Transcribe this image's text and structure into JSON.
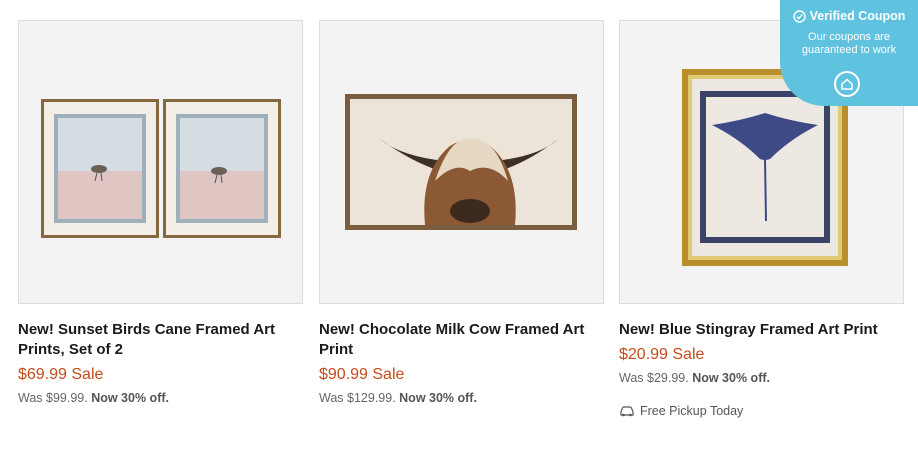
{
  "products": [
    {
      "title": "New! Sunset Birds Cane Framed Art Prints, Set of 2",
      "price": "$69.99 Sale",
      "was": "Was $99.99.",
      "discount": "Now 30% off.",
      "image_icon": "framed-art-birds-image"
    },
    {
      "title": "New! Chocolate Milk Cow Framed Art Print",
      "price": "$90.99 Sale",
      "was": "Was $129.99.",
      "discount": "Now 30% off.",
      "image_icon": "framed-art-cow-image"
    },
    {
      "title": "New! Blue Stingray Framed Art Print",
      "price": "$20.99 Sale",
      "was": "Was $29.99.",
      "discount": "Now 30% off.",
      "pickup": "Free Pickup Today",
      "image_icon": "framed-art-stingray-image"
    }
  ],
  "coupon": {
    "title": "Verified Coupon",
    "subtitle": "Our coupons are guaranteed to work",
    "color": "#5fc2df"
  },
  "colors": {
    "sale": "#c44b1c",
    "text": "#1b1b1b",
    "muted": "#666666"
  }
}
